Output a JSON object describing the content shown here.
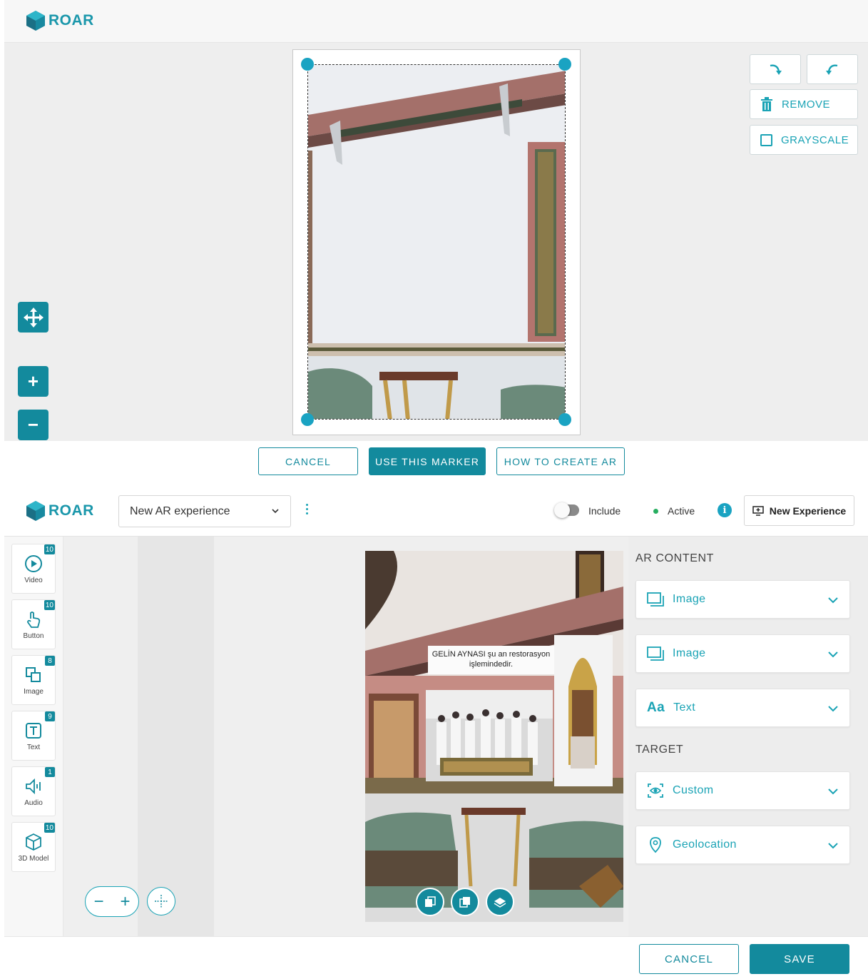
{
  "brand": {
    "name": "ROAR",
    "color": "#1b97ab"
  },
  "marker_editor": {
    "tools": {
      "rotate_right_icon": "rotate-right-icon",
      "rotate_left_icon": "rotate-left-icon",
      "remove_label": "REMOVE",
      "grayscale_label": "GRAYSCALE"
    },
    "side_controls": {
      "move_icon": "move-arrows-icon",
      "zoom_in": "+",
      "zoom_out": "−"
    },
    "footer": {
      "cancel_label": "CANCEL",
      "use_marker_label": "USE THIS MARKER",
      "how_to_label": "HOW TO CREATE AR"
    }
  },
  "experience_editor": {
    "header": {
      "experience_name": "New AR experience",
      "include_label": "Include",
      "include_on": false,
      "active_label": "Active",
      "info_icon": "i",
      "new_experience_label": "New Experience"
    },
    "widgets": [
      {
        "label": "Video",
        "count": "10",
        "icon": "play-circle-icon"
      },
      {
        "label": "Button",
        "count": "10",
        "icon": "tap-hand-icon"
      },
      {
        "label": "Image",
        "count": "8",
        "icon": "image-layers-icon"
      },
      {
        "label": "Text",
        "count": "9",
        "icon": "text-box-icon"
      },
      {
        "label": "Audio",
        "count": "1",
        "icon": "speaker-icon"
      },
      {
        "label": "3D Model",
        "count": "10",
        "icon": "cube-icon"
      }
    ],
    "zoom": {
      "minus": "−",
      "plus": "+"
    },
    "scene": {
      "caption": "GELİN AYNASI şu an restorasyon işlemindedir."
    },
    "ar_content": {
      "title": "AR CONTENT",
      "items": [
        {
          "label": "Image",
          "icon": "image-icon"
        },
        {
          "label": "Image",
          "icon": "image-icon"
        },
        {
          "label": "Text",
          "icon": "Aa"
        }
      ]
    },
    "target": {
      "title": "TARGET",
      "items": [
        {
          "label": "Custom",
          "icon": "eye-scan-icon"
        },
        {
          "label": "Geolocation",
          "icon": "location-pin-icon"
        }
      ]
    },
    "footer": {
      "cancel_label": "CANCEL",
      "save_label": "SAVE"
    }
  },
  "colors": {
    "accent": "#138a9d",
    "accent_light": "#1aa3b5",
    "active": "#27ae60"
  }
}
